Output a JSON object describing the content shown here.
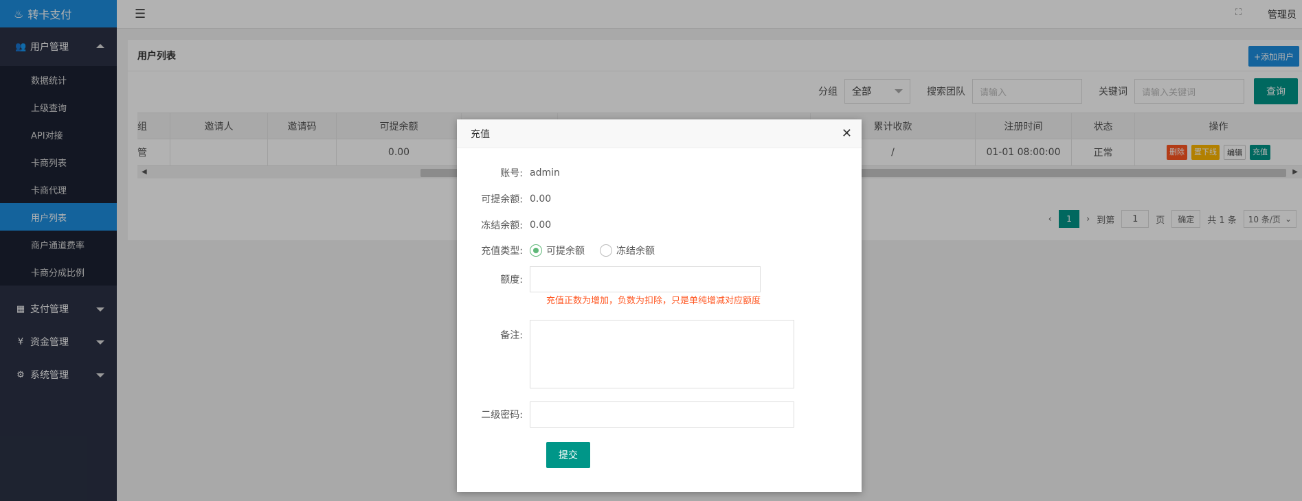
{
  "app": {
    "title": "转卡支付",
    "admin": "管理员"
  },
  "sidebar": {
    "user_group": "用户管理",
    "items": [
      {
        "label": "数据统计"
      },
      {
        "label": "上级查询"
      },
      {
        "label": "API对接"
      },
      {
        "label": "卡商列表"
      },
      {
        "label": "卡商代理"
      },
      {
        "label": "用户列表"
      },
      {
        "label": "商户通道费率"
      },
      {
        "label": "卡商分成比例"
      }
    ],
    "groups": [
      {
        "label": "支付管理"
      },
      {
        "label": "资金管理"
      },
      {
        "label": "系统管理"
      }
    ]
  },
  "page": {
    "title": "用户列表",
    "add_label": "+添加用户",
    "filters": {
      "group_label": "分组",
      "group_value": "全部",
      "team_label": "搜索团队",
      "team_placeholder": "请输入",
      "keyword_label": "关键词",
      "keyword_placeholder": "请输入关键词",
      "query_label": "查询"
    },
    "table": {
      "headers": [
        "组",
        "邀请人",
        "邀请码",
        "可提余额",
        "",
        "",
        "累计收款",
        "注册时间",
        "状态",
        "操作"
      ],
      "row": [
        "管",
        "",
        "",
        "0.00",
        "",
        "",
        "/",
        "01-01 08:00:00",
        "正常"
      ],
      "ops": [
        "删除",
        "置下线",
        "编辑",
        "充值"
      ]
    },
    "pager": {
      "current": "1",
      "goto_label": "到第",
      "goto_value": "1",
      "page_unit": "页",
      "confirm": "确定",
      "total": "共 1 条",
      "per_page": "10 条/页"
    }
  },
  "modal": {
    "title": "充值",
    "account_label": "账号:",
    "account_value": "admin",
    "avail_label": "可提余额:",
    "avail_value": "0.00",
    "frozen_label": "冻结余额:",
    "frozen_value": "0.00",
    "type_label": "充值类型:",
    "type_options": [
      "可提余额",
      "冻结余额"
    ],
    "amount_label": "额度:",
    "hint": "充值正数为增加，负数为扣除，只是单纯增减对应额度",
    "remark_label": "备注:",
    "pwd_label": "二级密码:",
    "submit_label": "提交"
  },
  "colors": {
    "brand": "#1e8fe0",
    "primary": "#009688",
    "danger": "#ff5722",
    "warn": "#ffb800"
  }
}
